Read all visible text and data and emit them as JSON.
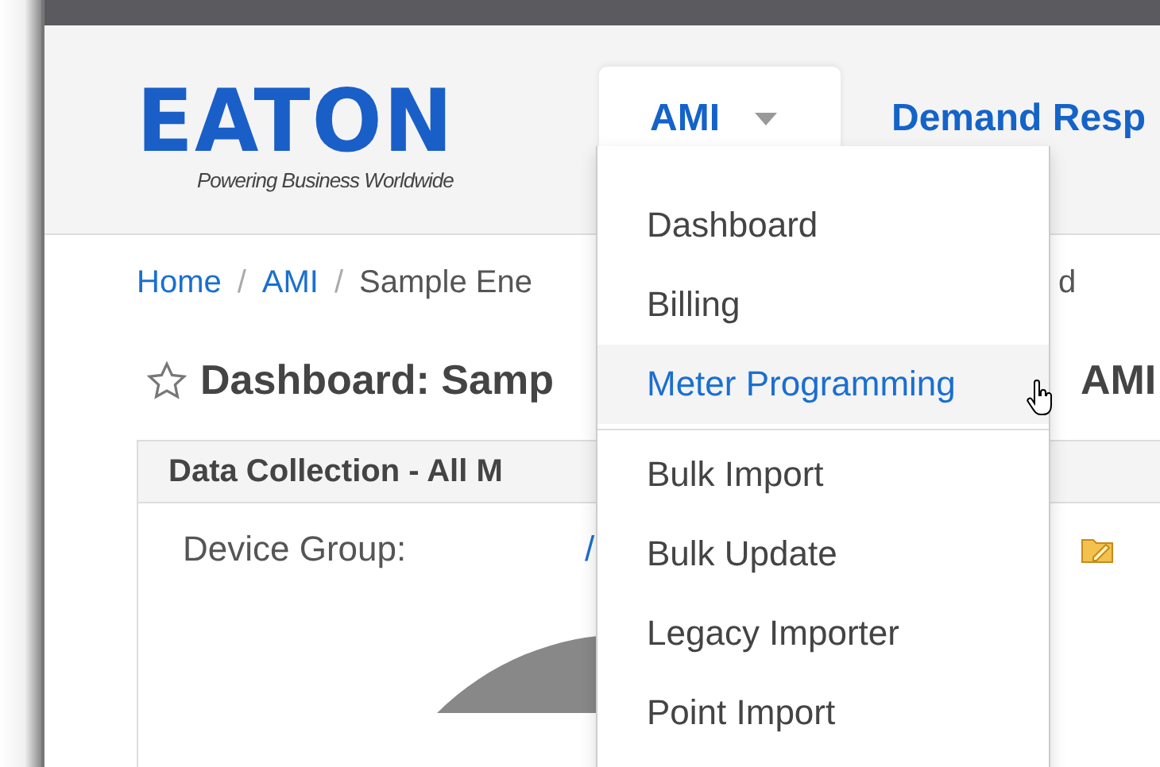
{
  "logo": {
    "wordmark": "EATON",
    "tagline": "Powering Business Worldwide"
  },
  "nav_tabs": [
    {
      "label": "AMI",
      "selected": true,
      "caret": true
    },
    {
      "label": "Demand Resp",
      "selected": false
    }
  ],
  "dropdown": {
    "items": [
      {
        "kind": "link",
        "label": "Dashboard",
        "selected": false
      },
      {
        "kind": "link",
        "label": "Billing",
        "selected": false
      },
      {
        "kind": "link",
        "label": "Meter Programming",
        "selected": true
      },
      {
        "kind": "divider"
      },
      {
        "kind": "link",
        "label": "Bulk Import",
        "selected": false
      },
      {
        "kind": "link",
        "label": "Bulk Update",
        "selected": false
      },
      {
        "kind": "link",
        "label": "Legacy Importer",
        "selected": false
      },
      {
        "kind": "link",
        "label": "Point Import",
        "selected": false
      }
    ]
  },
  "breadcrumb": {
    "items": [
      {
        "kind": "link",
        "label": "Home"
      },
      {
        "kind": "separator",
        "label": "/"
      },
      {
        "kind": "link",
        "label": "AMI"
      },
      {
        "kind": "separator",
        "label": "/"
      },
      {
        "kind": "text",
        "label": "Sample Ene"
      }
    ],
    "tail": "d"
  },
  "page_title": {
    "starred": false,
    "text": "Dashboard: Samp",
    "tail": "AMI"
  },
  "panel": {
    "title": "Data Collection - All M",
    "device_group_label": "Device Group:",
    "device_group_value": "/"
  }
}
